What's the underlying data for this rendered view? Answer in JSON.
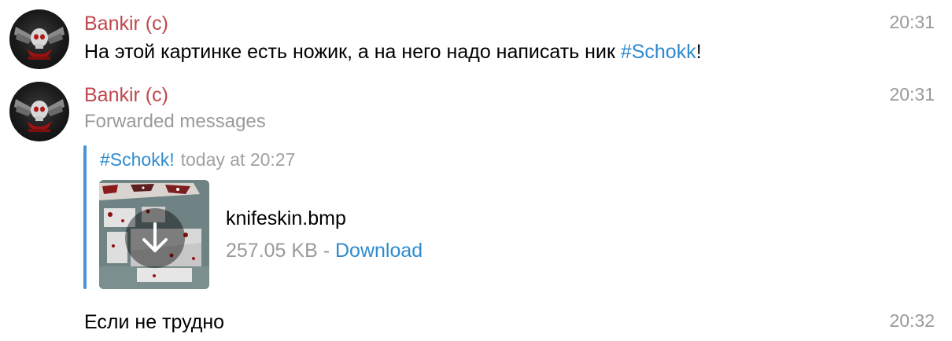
{
  "messages": [
    {
      "sender": "Bankir (c)",
      "time": "20:31",
      "text_before": "На этой картинке есть ножик, а на него надо написать ник ",
      "hashtag": "#Schokk",
      "text_after": "!"
    },
    {
      "sender": "Bankir (c)",
      "time": "20:31",
      "service": "Forwarded messages",
      "forwarded": {
        "from": "#Schokk!",
        "date": "today at 20:27",
        "file_name": "knifeskin.bmp",
        "file_size": "257.05 KB",
        "separator": " - ",
        "download_label": "Download"
      }
    },
    {
      "text": "Если не трудно",
      "time": "20:32"
    }
  ],
  "colors": {
    "sender_name": "#c0474d",
    "link": "#2f8bcf",
    "muted": "#9a9a9a",
    "forward_bar": "#4a95d4"
  },
  "icons": {
    "avatar": "skull-wings-avatar",
    "download": "download-arrow-icon"
  }
}
